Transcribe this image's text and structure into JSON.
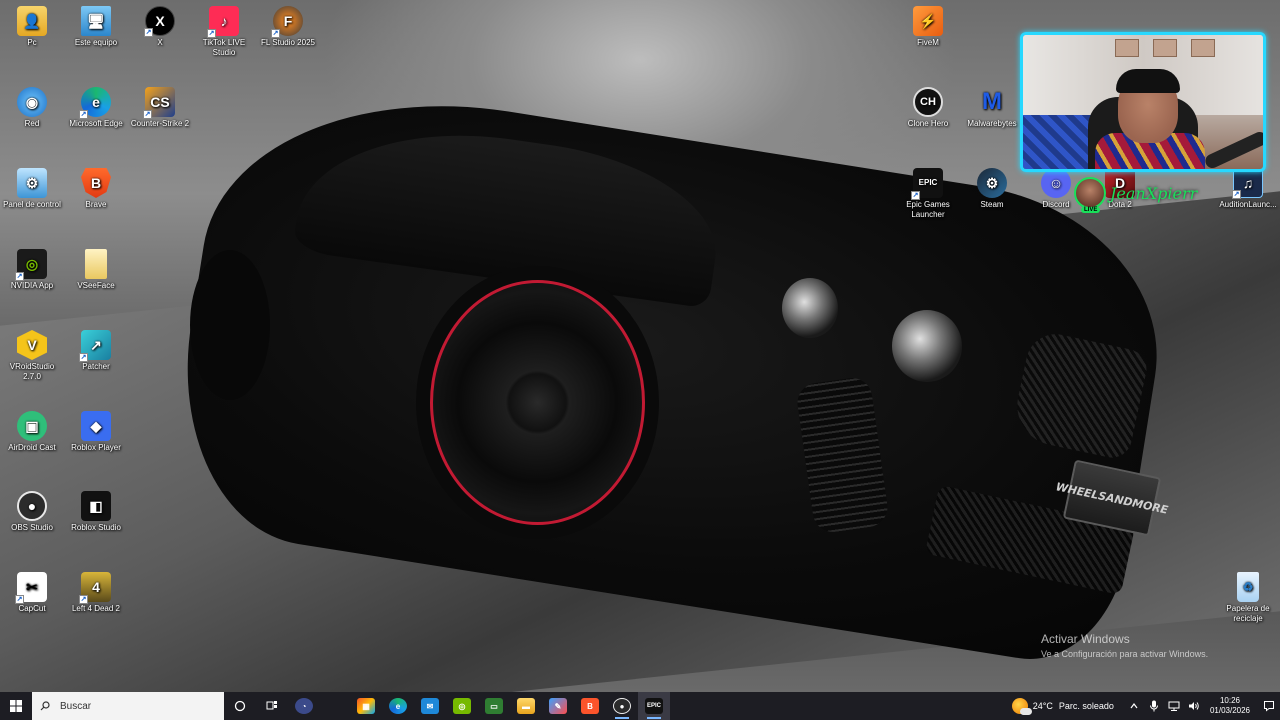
{
  "desktop": {
    "icons_left": [
      {
        "label": "Pc",
        "icon": "folder-user-icon"
      },
      {
        "label": "Este equipo",
        "icon": "computer-icon"
      },
      {
        "label": "X",
        "icon": "x-logo-icon"
      },
      {
        "label": "TikTok LIVE Studio",
        "icon": "tiktok-icon"
      },
      {
        "label": "FL Studio 2025",
        "icon": "fl-studio-icon"
      },
      {
        "label": "Red",
        "icon": "network-globe-icon"
      },
      {
        "label": "Microsoft Edge",
        "icon": "edge-icon"
      },
      {
        "label": "Counter-Strike 2",
        "icon": "counter-strike-icon"
      },
      {
        "label": "Panel de control",
        "icon": "control-panel-icon"
      },
      {
        "label": "Brave",
        "icon": "brave-lion-icon"
      },
      {
        "label": "NVIDIA App",
        "icon": "nvidia-icon"
      },
      {
        "label": "VSeeFace",
        "icon": "file-icon"
      },
      {
        "label": "VRoidStudio 2.7.0",
        "icon": "vroid-icon"
      },
      {
        "label": "Patcher",
        "icon": "patcher-icon"
      },
      {
        "label": "AirDroid Cast",
        "icon": "airdroid-icon"
      },
      {
        "label": "Roblox Player",
        "icon": "roblox-icon"
      },
      {
        "label": "OBS Studio",
        "icon": "obs-icon"
      },
      {
        "label": "Roblox Studio",
        "icon": "roblox-studio-icon"
      },
      {
        "label": "CapCut",
        "icon": "capcut-icon"
      },
      {
        "label": "Left 4 Dead 2",
        "icon": "left4dead-icon"
      }
    ],
    "icons_right": [
      {
        "label": "FiveM",
        "icon": "fivem-icon"
      },
      {
        "label": "Clone Hero",
        "icon": "clone-hero-icon"
      },
      {
        "label": "Malwarebytes",
        "icon": "malwarebytes-icon"
      },
      {
        "label": "Epic Games Launcher",
        "icon": "epic-games-icon"
      },
      {
        "label": "Steam",
        "icon": "steam-icon"
      },
      {
        "label": "Discord",
        "icon": "discord-icon"
      },
      {
        "label": "Dota 2",
        "icon": "dota-icon"
      },
      {
        "label": "AuditionLaunc...",
        "icon": "audition-icon"
      }
    ],
    "recycle_bin": {
      "label": "Papelera de reciclaje",
      "icon": "recycle-bin-icon"
    },
    "wallpaper_plate": "WHEELSANDMORE"
  },
  "stream_overlay": {
    "streamer_name": "JeanXpierr",
    "live_badge": "LIVE",
    "webcam_frame_color": "#27d8ff",
    "name_color": "#19e05a"
  },
  "watermark": {
    "title": "Activar Windows",
    "subtitle": "Ve a Configuración para activar Windows."
  },
  "taskbar": {
    "search_placeholder": "Buscar",
    "apps": [
      {
        "icon": "task-view-icon"
      },
      {
        "icon": "task-switch-icon"
      },
      {
        "icon": "speed-gauge-icon"
      },
      {
        "icon": "microsoft-store-icon"
      },
      {
        "icon": "edge-icon"
      },
      {
        "icon": "mail-icon"
      },
      {
        "icon": "nvidia-icon"
      },
      {
        "icon": "monitor-app-icon"
      },
      {
        "icon": "file-explorer-icon"
      },
      {
        "icon": "paint-app-icon"
      },
      {
        "icon": "brave-lion-icon"
      },
      {
        "icon": "obs-icon"
      },
      {
        "icon": "epic-games-icon"
      }
    ],
    "weather": {
      "temp": "24°C",
      "condition": "Parc. soleado"
    },
    "time": "10:26",
    "date": "01/03/2026"
  }
}
